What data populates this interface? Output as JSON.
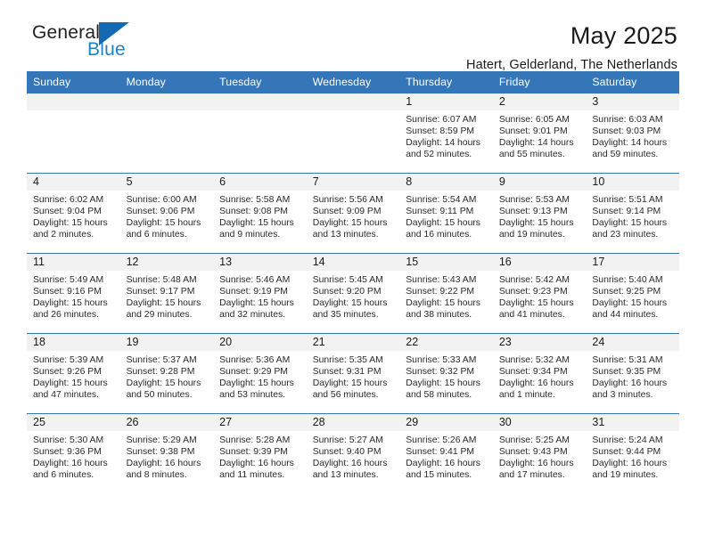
{
  "brand": {
    "name_part1": "General",
    "name_part2": "Blue"
  },
  "header": {
    "title": "May 2025",
    "location": "Hatert, Gelderland, The Netherlands"
  },
  "weekday_headers": [
    "Sunday",
    "Monday",
    "Tuesday",
    "Wednesday",
    "Thursday",
    "Friday",
    "Saturday"
  ],
  "colors": {
    "header_blue": "#3476b8",
    "brand_blue": "#1b84c8",
    "daynum_bg": "#f2f2f2",
    "text": "#1a1a1a"
  },
  "labels": {
    "sunrise_prefix": "Sunrise:",
    "sunset_prefix": "Sunset:",
    "daylight_prefix": "Daylight:"
  },
  "weeks": [
    [
      {
        "day": "",
        "sunrise": "",
        "sunset": "",
        "daylight_1": "",
        "daylight_2": "",
        "blank": true
      },
      {
        "day": "",
        "sunrise": "",
        "sunset": "",
        "daylight_1": "",
        "daylight_2": "",
        "blank": true
      },
      {
        "day": "",
        "sunrise": "",
        "sunset": "",
        "daylight_1": "",
        "daylight_2": "",
        "blank": true
      },
      {
        "day": "",
        "sunrise": "",
        "sunset": "",
        "daylight_1": "",
        "daylight_2": "",
        "blank": true
      },
      {
        "day": "1",
        "sunrise": "Sunrise: 6:07 AM",
        "sunset": "Sunset: 8:59 PM",
        "daylight_1": "Daylight: 14 hours",
        "daylight_2": "and 52 minutes."
      },
      {
        "day": "2",
        "sunrise": "Sunrise: 6:05 AM",
        "sunset": "Sunset: 9:01 PM",
        "daylight_1": "Daylight: 14 hours",
        "daylight_2": "and 55 minutes."
      },
      {
        "day": "3",
        "sunrise": "Sunrise: 6:03 AM",
        "sunset": "Sunset: 9:03 PM",
        "daylight_1": "Daylight: 14 hours",
        "daylight_2": "and 59 minutes."
      }
    ],
    [
      {
        "day": "4",
        "sunrise": "Sunrise: 6:02 AM",
        "sunset": "Sunset: 9:04 PM",
        "daylight_1": "Daylight: 15 hours",
        "daylight_2": "and 2 minutes."
      },
      {
        "day": "5",
        "sunrise": "Sunrise: 6:00 AM",
        "sunset": "Sunset: 9:06 PM",
        "daylight_1": "Daylight: 15 hours",
        "daylight_2": "and 6 minutes."
      },
      {
        "day": "6",
        "sunrise": "Sunrise: 5:58 AM",
        "sunset": "Sunset: 9:08 PM",
        "daylight_1": "Daylight: 15 hours",
        "daylight_2": "and 9 minutes."
      },
      {
        "day": "7",
        "sunrise": "Sunrise: 5:56 AM",
        "sunset": "Sunset: 9:09 PM",
        "daylight_1": "Daylight: 15 hours",
        "daylight_2": "and 13 minutes."
      },
      {
        "day": "8",
        "sunrise": "Sunrise: 5:54 AM",
        "sunset": "Sunset: 9:11 PM",
        "daylight_1": "Daylight: 15 hours",
        "daylight_2": "and 16 minutes."
      },
      {
        "day": "9",
        "sunrise": "Sunrise: 5:53 AM",
        "sunset": "Sunset: 9:13 PM",
        "daylight_1": "Daylight: 15 hours",
        "daylight_2": "and 19 minutes."
      },
      {
        "day": "10",
        "sunrise": "Sunrise: 5:51 AM",
        "sunset": "Sunset: 9:14 PM",
        "daylight_1": "Daylight: 15 hours",
        "daylight_2": "and 23 minutes."
      }
    ],
    [
      {
        "day": "11",
        "sunrise": "Sunrise: 5:49 AM",
        "sunset": "Sunset: 9:16 PM",
        "daylight_1": "Daylight: 15 hours",
        "daylight_2": "and 26 minutes."
      },
      {
        "day": "12",
        "sunrise": "Sunrise: 5:48 AM",
        "sunset": "Sunset: 9:17 PM",
        "daylight_1": "Daylight: 15 hours",
        "daylight_2": "and 29 minutes."
      },
      {
        "day": "13",
        "sunrise": "Sunrise: 5:46 AM",
        "sunset": "Sunset: 9:19 PM",
        "daylight_1": "Daylight: 15 hours",
        "daylight_2": "and 32 minutes."
      },
      {
        "day": "14",
        "sunrise": "Sunrise: 5:45 AM",
        "sunset": "Sunset: 9:20 PM",
        "daylight_1": "Daylight: 15 hours",
        "daylight_2": "and 35 minutes."
      },
      {
        "day": "15",
        "sunrise": "Sunrise: 5:43 AM",
        "sunset": "Sunset: 9:22 PM",
        "daylight_1": "Daylight: 15 hours",
        "daylight_2": "and 38 minutes."
      },
      {
        "day": "16",
        "sunrise": "Sunrise: 5:42 AM",
        "sunset": "Sunset: 9:23 PM",
        "daylight_1": "Daylight: 15 hours",
        "daylight_2": "and 41 minutes."
      },
      {
        "day": "17",
        "sunrise": "Sunrise: 5:40 AM",
        "sunset": "Sunset: 9:25 PM",
        "daylight_1": "Daylight: 15 hours",
        "daylight_2": "and 44 minutes."
      }
    ],
    [
      {
        "day": "18",
        "sunrise": "Sunrise: 5:39 AM",
        "sunset": "Sunset: 9:26 PM",
        "daylight_1": "Daylight: 15 hours",
        "daylight_2": "and 47 minutes."
      },
      {
        "day": "19",
        "sunrise": "Sunrise: 5:37 AM",
        "sunset": "Sunset: 9:28 PM",
        "daylight_1": "Daylight: 15 hours",
        "daylight_2": "and 50 minutes."
      },
      {
        "day": "20",
        "sunrise": "Sunrise: 5:36 AM",
        "sunset": "Sunset: 9:29 PM",
        "daylight_1": "Daylight: 15 hours",
        "daylight_2": "and 53 minutes."
      },
      {
        "day": "21",
        "sunrise": "Sunrise: 5:35 AM",
        "sunset": "Sunset: 9:31 PM",
        "daylight_1": "Daylight: 15 hours",
        "daylight_2": "and 56 minutes."
      },
      {
        "day": "22",
        "sunrise": "Sunrise: 5:33 AM",
        "sunset": "Sunset: 9:32 PM",
        "daylight_1": "Daylight: 15 hours",
        "daylight_2": "and 58 minutes."
      },
      {
        "day": "23",
        "sunrise": "Sunrise: 5:32 AM",
        "sunset": "Sunset: 9:34 PM",
        "daylight_1": "Daylight: 16 hours",
        "daylight_2": "and 1 minute."
      },
      {
        "day": "24",
        "sunrise": "Sunrise: 5:31 AM",
        "sunset": "Sunset: 9:35 PM",
        "daylight_1": "Daylight: 16 hours",
        "daylight_2": "and 3 minutes."
      }
    ],
    [
      {
        "day": "25",
        "sunrise": "Sunrise: 5:30 AM",
        "sunset": "Sunset: 9:36 PM",
        "daylight_1": "Daylight: 16 hours",
        "daylight_2": "and 6 minutes."
      },
      {
        "day": "26",
        "sunrise": "Sunrise: 5:29 AM",
        "sunset": "Sunset: 9:38 PM",
        "daylight_1": "Daylight: 16 hours",
        "daylight_2": "and 8 minutes."
      },
      {
        "day": "27",
        "sunrise": "Sunrise: 5:28 AM",
        "sunset": "Sunset: 9:39 PM",
        "daylight_1": "Daylight: 16 hours",
        "daylight_2": "and 11 minutes."
      },
      {
        "day": "28",
        "sunrise": "Sunrise: 5:27 AM",
        "sunset": "Sunset: 9:40 PM",
        "daylight_1": "Daylight: 16 hours",
        "daylight_2": "and 13 minutes."
      },
      {
        "day": "29",
        "sunrise": "Sunrise: 5:26 AM",
        "sunset": "Sunset: 9:41 PM",
        "daylight_1": "Daylight: 16 hours",
        "daylight_2": "and 15 minutes."
      },
      {
        "day": "30",
        "sunrise": "Sunrise: 5:25 AM",
        "sunset": "Sunset: 9:43 PM",
        "daylight_1": "Daylight: 16 hours",
        "daylight_2": "and 17 minutes."
      },
      {
        "day": "31",
        "sunrise": "Sunrise: 5:24 AM",
        "sunset": "Sunset: 9:44 PM",
        "daylight_1": "Daylight: 16 hours",
        "daylight_2": "and 19 minutes."
      }
    ]
  ]
}
